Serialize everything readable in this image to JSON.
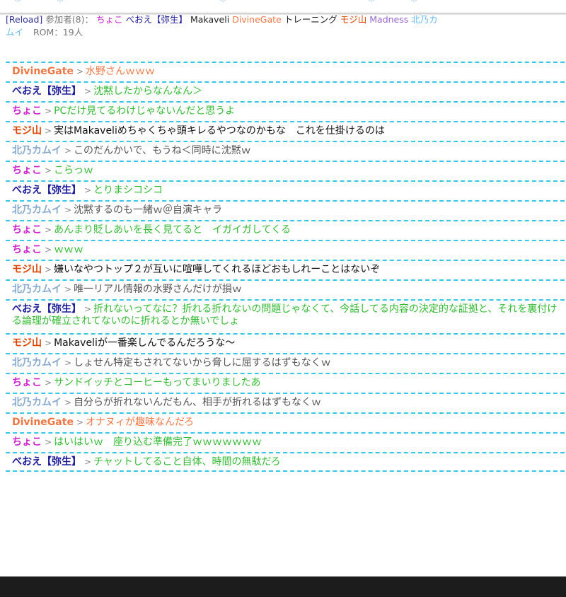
{
  "colors": {
    "choko": "#cc22cc",
    "beoe_name": "#1a1a99",
    "beoe_text": "#33bb33",
    "mojiyama_name": "#dd4400",
    "mojiyama_text": "#111111",
    "kitano": "#88aacc",
    "kitano_text": "#555555",
    "divine_name": "#ee7744",
    "divine_text": "#ee7744",
    "green_text": "#33bb33",
    "separator": "#38c7e8"
  },
  "header": {
    "reload_label": "[Reload]",
    "participants_label": "参加者(8)：",
    "participants": [
      {
        "name": "ちょこ",
        "color": "#cc22cc"
      },
      {
        "name": "べおえ【弥生】",
        "color": "#1a1a99"
      },
      {
        "name": "Makaveli",
        "color": "#222222"
      },
      {
        "name": "DivineGate",
        "color": "#ee7744"
      },
      {
        "name": "トレーニング",
        "color": "#222222"
      },
      {
        "name": "モジ山",
        "color": "#dd4400"
      },
      {
        "name": "Madness",
        "color": "#9966cc"
      },
      {
        "name": "北乃カムイ",
        "color": "#66bbee"
      }
    ],
    "rom": "ROM：19人"
  },
  "messages": [
    {
      "name": "DivineGate",
      "text": "水野さんｗｗｗ",
      "name_color": "#ee7744",
      "text_color": "#ee7744"
    },
    {
      "name": "べおえ【弥生】",
      "text": "沈黙したからなんなん＞",
      "name_color": "#1a1a99",
      "text_color": "#33bb33"
    },
    {
      "name": "ちょこ",
      "text": "PCだけ見てるわけじゃないんだと思うよ",
      "name_color": "#cc22cc",
      "text_color": "#33bb33"
    },
    {
      "name": "モジ山",
      "text": "実はMakaveliめちゃくちゃ頭キレるやつなのかもな　これを仕掛けるのは",
      "name_color": "#dd4400",
      "text_color": "#111111"
    },
    {
      "name": "北乃カムイ",
      "text": "このだんかいで、もうね＜同時に沈黙ｗ",
      "name_color": "#88aacc",
      "text_color": "#555555"
    },
    {
      "name": "ちょこ",
      "text": "こらっｗ",
      "name_color": "#cc22cc",
      "text_color": "#33bb33"
    },
    {
      "name": "べおえ【弥生】",
      "text": "とりまシコシコ",
      "name_color": "#1a1a99",
      "text_color": "#33bb33"
    },
    {
      "name": "北乃カムイ",
      "text": "沈黙するのも一緒ｗ＠自演キャラ",
      "name_color": "#88aacc",
      "text_color": "#555555"
    },
    {
      "name": "ちょこ",
      "text": "あんまり貶しあいを長く見てると　イガイガしてくる",
      "name_color": "#cc22cc",
      "text_color": "#33bb33"
    },
    {
      "name": "ちょこ",
      "text": "ｗｗｗ",
      "name_color": "#cc22cc",
      "text_color": "#33bb33"
    },
    {
      "name": "モジ山",
      "text": "嫌いなやつトップ２が互いに喧嘩してくれるほどおもしれーことはないぞ",
      "name_color": "#dd4400",
      "text_color": "#111111"
    },
    {
      "name": "北乃カムイ",
      "text": "唯一リアル情報の水野さんだけが損ｗ",
      "name_color": "#88aacc",
      "text_color": "#555555"
    },
    {
      "name": "べおえ【弥生】",
      "text": "折れないってなに？折れる折れないの問題じゃなくて、今話してる内容の決定的な証拠と、それを裏付ける論理が確立されてないのに折れるとか無いでしょ",
      "name_color": "#1a1a99",
      "text_color": "#33bb33",
      "tall": true
    },
    {
      "name": "モジ山",
      "text": "Makaveliが一番楽しんでるんだろうな～",
      "name_color": "#dd4400",
      "text_color": "#111111"
    },
    {
      "name": "北乃カムイ",
      "text": "しょせん特定もされてないから脅しに屈するはずもなくｗ",
      "name_color": "#88aacc",
      "text_color": "#555555"
    },
    {
      "name": "ちょこ",
      "text": "サンドイッチとコーヒーもってまいりましたあ",
      "name_color": "#cc22cc",
      "text_color": "#33bb33"
    },
    {
      "name": "北乃カムイ",
      "text": "自分らが折れないんだもん、相手が折れるはずもなくｗ",
      "name_color": "#88aacc",
      "text_color": "#555555"
    },
    {
      "name": "DivineGate",
      "text": "オナヌィが趣味なんだろ",
      "name_color": "#ee7744",
      "text_color": "#ee7744"
    },
    {
      "name": "ちょこ",
      "text": "はいはいｗ　座り込む準備完了ｗｗｗｗｗｗｗ",
      "name_color": "#cc22cc",
      "text_color": "#33bb33"
    },
    {
      "name": "べおえ【弥生】",
      "text": "チャットしてること自体、時間の無駄だろ",
      "name_color": "#1a1a99",
      "text_color": "#33bb33"
    }
  ],
  "separator_glyph": ">"
}
